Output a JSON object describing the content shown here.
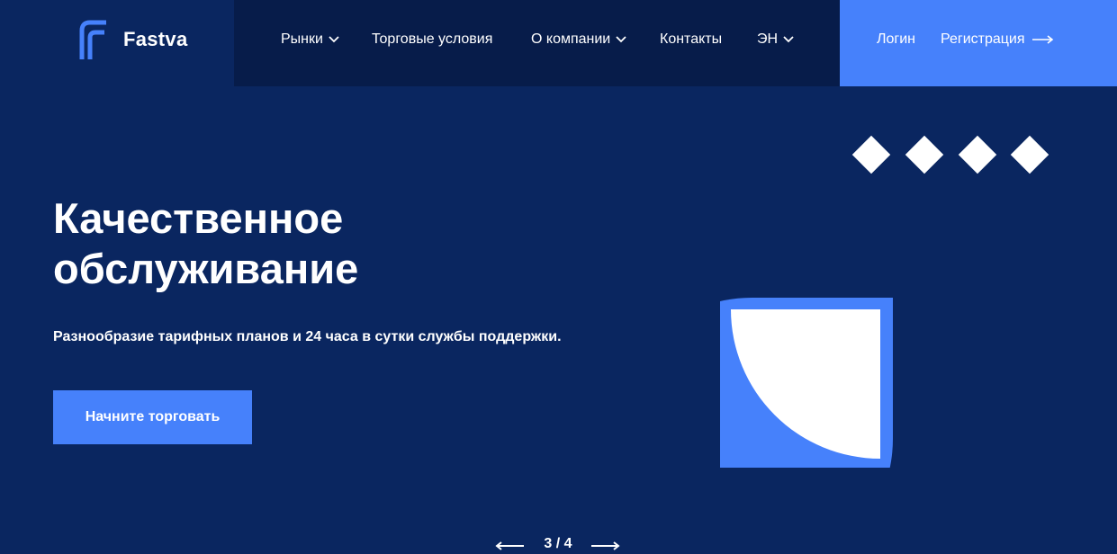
{
  "brand": {
    "name": "Fastva",
    "logo_icon": "fastva-logo-icon"
  },
  "nav": {
    "items": [
      {
        "label": "Рынки",
        "has_dropdown": true
      },
      {
        "label": "Торговые условия",
        "has_dropdown": false
      },
      {
        "label": "О компании",
        "has_dropdown": true
      },
      {
        "label": "Контакты",
        "has_dropdown": false
      },
      {
        "label": "ЭН",
        "has_dropdown": true
      }
    ]
  },
  "auth": {
    "login_label": "Логин",
    "register_label": "Регистрация"
  },
  "hero": {
    "title_line1": "Качественное",
    "title_line2": "обслуживание",
    "subtitle": "Разнообразие тарифных планов и 24 часа в сутки службы поддержки.",
    "cta_label": "Начните торговать"
  },
  "pager": {
    "text": "3 / 4"
  },
  "colors": {
    "background": "#0a2660",
    "nav_background": "#071c4a",
    "accent": "#4681fb",
    "white": "#ffffff"
  }
}
